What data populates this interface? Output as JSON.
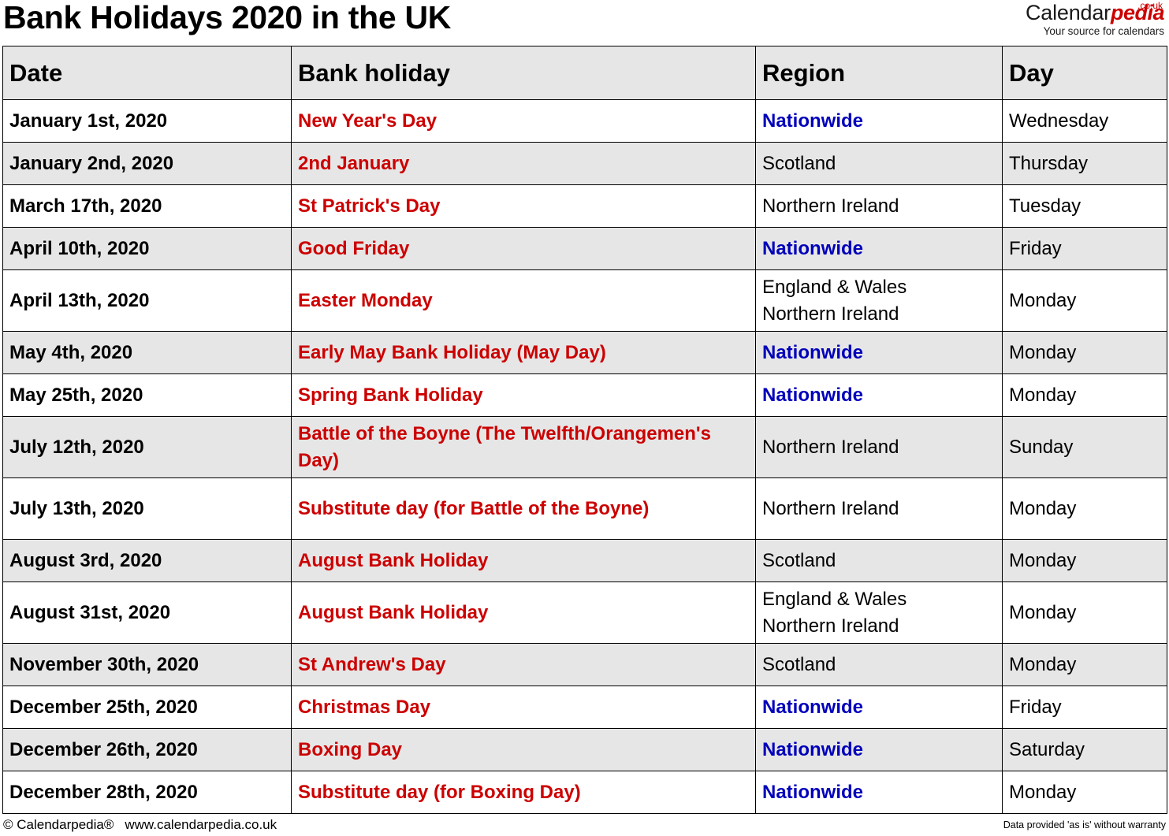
{
  "header": {
    "title": "Bank Holidays 2020 in the UK",
    "logo": {
      "brand_first": "Calendar",
      "brand_second": "pedia",
      "tld": ".co.uk",
      "tagline": "Your source for calendars"
    }
  },
  "colors": {
    "holiday_name": "#CC0000",
    "nationwide": "#0000BB",
    "header_fill": "#E6E6E6",
    "row_shade": "#E6E6E6",
    "text": "#000000",
    "border": "#000000"
  },
  "table": {
    "columns": [
      "Date",
      "Bank holiday",
      "Region",
      "Day"
    ],
    "rows": [
      {
        "date": "January 1st, 2020",
        "holiday": "New Year's Day",
        "region": [
          "Nationwide"
        ],
        "day": "Wednesday",
        "nationwide": true,
        "shaded": false,
        "tall": false
      },
      {
        "date": "January 2nd, 2020",
        "holiday": "2nd January",
        "region": [
          "Scotland"
        ],
        "day": "Thursday",
        "nationwide": false,
        "shaded": true,
        "tall": false
      },
      {
        "date": "March 17th, 2020",
        "holiday": "St Patrick's Day",
        "region": [
          "Northern Ireland"
        ],
        "day": "Tuesday",
        "nationwide": false,
        "shaded": false,
        "tall": false
      },
      {
        "date": "April 10th, 2020",
        "holiday": "Good Friday",
        "region": [
          "Nationwide"
        ],
        "day": "Friday",
        "nationwide": true,
        "shaded": true,
        "tall": false
      },
      {
        "date": "April 13th, 2020",
        "holiday": "Easter Monday",
        "region": [
          "England & Wales",
          "Northern Ireland"
        ],
        "day": "Monday",
        "nationwide": false,
        "shaded": false,
        "tall": true
      },
      {
        "date": "May 4th, 2020",
        "holiday": "Early May Bank Holiday (May Day)",
        "region": [
          "Nationwide"
        ],
        "day": "Monday",
        "nationwide": true,
        "shaded": true,
        "tall": false
      },
      {
        "date": "May 25th, 2020",
        "holiday": "Spring Bank Holiday",
        "region": [
          "Nationwide"
        ],
        "day": "Monday",
        "nationwide": true,
        "shaded": false,
        "tall": false
      },
      {
        "date": "July 12th, 2020",
        "holiday": "Battle of the Boyne (The Twelfth/Orangemen's Day)",
        "region": [
          "Northern Ireland"
        ],
        "day": "Sunday",
        "nationwide": false,
        "shaded": true,
        "tall": true
      },
      {
        "date": "July 13th, 2020",
        "holiday": "Substitute day (for Battle of the Boyne)",
        "region": [
          "Northern Ireland"
        ],
        "day": "Monday",
        "nationwide": false,
        "shaded": false,
        "tall": true
      },
      {
        "date": "August 3rd, 2020",
        "holiday": "August Bank Holiday",
        "region": [
          "Scotland"
        ],
        "day": "Monday",
        "nationwide": false,
        "shaded": true,
        "tall": false
      },
      {
        "date": "August 31st, 2020",
        "holiday": "August Bank Holiday",
        "region": [
          "England & Wales",
          "Northern Ireland"
        ],
        "day": "Monday",
        "nationwide": false,
        "shaded": false,
        "tall": true
      },
      {
        "date": "November 30th, 2020",
        "holiday": "St Andrew's Day",
        "region": [
          "Scotland"
        ],
        "day": "Monday",
        "nationwide": false,
        "shaded": true,
        "tall": false
      },
      {
        "date": "December 25th, 2020",
        "holiday": "Christmas Day",
        "region": [
          "Nationwide"
        ],
        "day": "Friday",
        "nationwide": true,
        "shaded": false,
        "tall": false
      },
      {
        "date": "December 26th, 2020",
        "holiday": "Boxing Day",
        "region": [
          "Nationwide"
        ],
        "day": "Saturday",
        "nationwide": true,
        "shaded": true,
        "tall": false
      },
      {
        "date": "December 28th, 2020",
        "holiday": "Substitute day (for Boxing Day)",
        "region": [
          "Nationwide"
        ],
        "day": "Monday",
        "nationwide": true,
        "shaded": false,
        "tall": false
      }
    ]
  },
  "footer": {
    "copyright": "© Calendarpedia®",
    "website": "www.calendarpedia.co.uk",
    "disclaimer": "Data provided 'as is' without warranty"
  }
}
